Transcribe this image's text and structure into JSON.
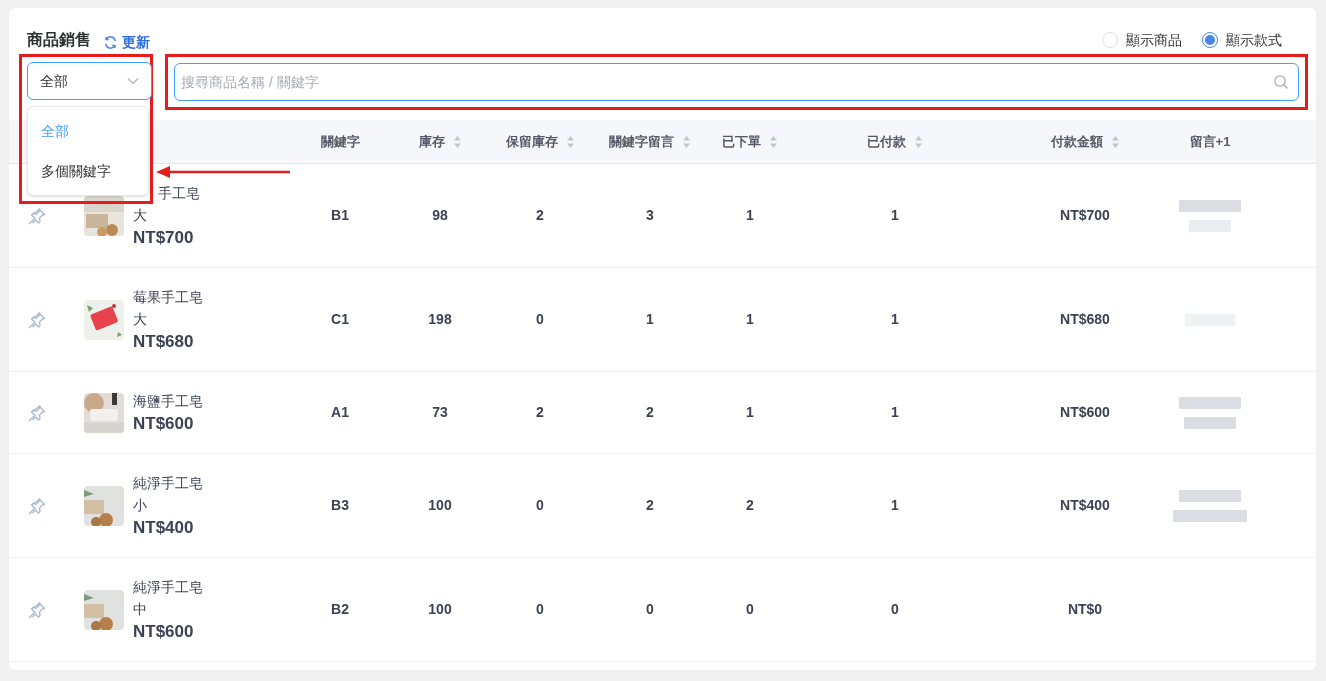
{
  "header": {
    "title": "商品銷售",
    "refresh": "更新"
  },
  "view_options": [
    {
      "label": "顯示商品",
      "selected": false
    },
    {
      "label": "顯示款式",
      "selected": true
    }
  ],
  "filter_select": {
    "value": "全部",
    "open": true,
    "highlighted": true,
    "options": [
      {
        "label": "全部",
        "selected": true
      },
      {
        "label": "多個關鍵字",
        "selected": false,
        "pointed": true
      }
    ]
  },
  "search": {
    "placeholder": "搜尋商品名稱 / 關鍵字",
    "highlighted": true
  },
  "table": {
    "columns": [
      {
        "label": "關鍵字",
        "sortable": false
      },
      {
        "label": "庫存",
        "sortable": true
      },
      {
        "label": "保留庫存",
        "sortable": true
      },
      {
        "label": "關鍵字留言",
        "sortable": true
      },
      {
        "label": "已下單",
        "sortable": true
      },
      {
        "label": "已付款",
        "sortable": true
      },
      {
        "label": "付款金額",
        "sortable": true
      },
      {
        "label": "留言+1",
        "sortable": false
      }
    ],
    "rows": [
      {
        "product": {
          "name_lines": [
            "手工皂",
            "大"
          ],
          "name_partly_hidden": true,
          "price": "NT$700"
        },
        "cells": [
          "B1",
          "98",
          "2",
          "3",
          "1",
          "1",
          "NT$700"
        ],
        "comments": [
          {
            "kind": "long"
          },
          {
            "kind": "short"
          }
        ]
      },
      {
        "product": {
          "name_lines": [
            "莓果手工皂",
            "大"
          ],
          "price": "NT$680"
        },
        "cells": [
          "C1",
          "198",
          "0",
          "1",
          "1",
          "1",
          "NT$680"
        ],
        "comments": [
          {
            "kind": "faint"
          }
        ]
      },
      {
        "product": {
          "name_lines": [
            "海鹽手工皂"
          ],
          "price": "NT$600"
        },
        "cells": [
          "A1",
          "73",
          "2",
          "2",
          "1",
          "1",
          "NT$600"
        ],
        "comments": [
          {
            "kind": "long"
          },
          {
            "kind": "medium"
          }
        ]
      },
      {
        "product": {
          "name_lines": [
            "純淨手工皂",
            "小"
          ],
          "price": "NT$400"
        },
        "cells": [
          "B3",
          "100",
          "0",
          "2",
          "2",
          "1",
          "NT$400"
        ],
        "comments": [
          {
            "kind": "long"
          },
          {
            "kind": "wide"
          }
        ]
      },
      {
        "product": {
          "name_lines": [
            "純淨手工皂",
            "中"
          ],
          "price": "NT$600"
        },
        "cells": [
          "B2",
          "100",
          "0",
          "0",
          "0",
          "0",
          "NT$0"
        ]
      }
    ]
  }
}
